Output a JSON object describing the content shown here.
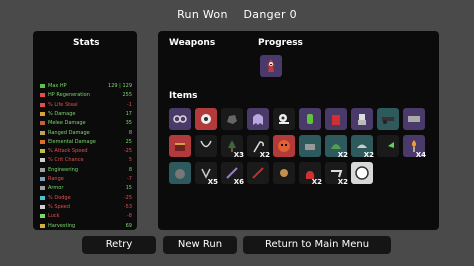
{
  "header": {
    "result": "Run Won",
    "danger": "Danger 0"
  },
  "stats": {
    "title": "Stats",
    "rows": [
      {
        "label": "Max HP",
        "value": "129 | 129",
        "color": "#7bd86d",
        "icon_color": "#5cc04a",
        "icon": "heart-icon"
      },
      {
        "label": "HP Regeneration",
        "value": "255",
        "color": "#7bd86d",
        "icon_color": "#e05050",
        "icon": "regen-icon"
      },
      {
        "label": "% Life Steal",
        "value": "-1",
        "color": "#e05050",
        "icon_color": "#e05050",
        "icon": "lifesteal-icon"
      },
      {
        "label": "% Damage",
        "value": "17",
        "color": "#7bd86d",
        "icon_color": "#d8a040",
        "icon": "damage-icon"
      },
      {
        "label": "Melee Damage",
        "value": "35",
        "color": "#7bd86d",
        "icon_color": "#c06040",
        "icon": "melee-icon"
      },
      {
        "label": "Ranged Damage",
        "value": "8",
        "color": "#7bd86d",
        "icon_color": "#c0a060",
        "icon": "ranged-icon"
      },
      {
        "label": "Elemental Damage",
        "value": "25",
        "color": "#7bd86d",
        "icon_color": "#e07020",
        "icon": "elemental-icon"
      },
      {
        "label": "% Attack Speed",
        "value": "-25",
        "color": "#e05050",
        "icon_color": "#c0c040",
        "icon": "attack-speed-icon"
      },
      {
        "label": "% Crit Chance",
        "value": "5",
        "color": "#e05050",
        "icon_color": "#d0d0d0",
        "icon": "crit-icon"
      },
      {
        "label": "Engineering",
        "value": "8",
        "color": "#7bd86d",
        "icon_color": "#a0a0a0",
        "icon": "engineering-icon"
      },
      {
        "label": "Range",
        "value": "-7",
        "color": "#e05050",
        "icon_color": "#80a0c0",
        "icon": "range-icon"
      },
      {
        "label": "Armor",
        "value": "15",
        "color": "#7bd86d",
        "icon_color": "#a0a0a0",
        "icon": "armor-icon"
      },
      {
        "label": "% Dodge",
        "value": "-25",
        "color": "#e05050",
        "icon_color": "#50c0d0",
        "icon": "dodge-icon"
      },
      {
        "label": "% Speed",
        "value": "-53",
        "color": "#e05050",
        "icon_color": "#d0d0d0",
        "icon": "speed-icon"
      },
      {
        "label": "Luck",
        "value": "-8",
        "color": "#e05050",
        "icon_color": "#7bd86d",
        "icon": "luck-icon"
      },
      {
        "label": "Harvesting",
        "value": "69",
        "color": "#7bd86d",
        "icon_color": "#d0b040",
        "icon": "harvesting-icon"
      }
    ]
  },
  "weapons": {
    "title": "Weapons"
  },
  "progress": {
    "title": "Progress",
    "items": [
      {
        "icon": "character-icon",
        "color": "#c03a3a"
      }
    ]
  },
  "items": {
    "title": "Items",
    "list": [
      {
        "icon": "goggles-icon",
        "bg": "#4a3a6a",
        "qty": ""
      },
      {
        "icon": "spiked-ball-icon",
        "bg": "#b33a3a",
        "qty": ""
      },
      {
        "icon": "rock-icon",
        "bg": "#1a1a1a",
        "qty": ""
      },
      {
        "icon": "ghost-icon",
        "bg": "#4a3a6a",
        "qty": ""
      },
      {
        "icon": "snail-icon",
        "bg": "#1a1a1a",
        "qty": ""
      },
      {
        "icon": "potion-icon",
        "bg": "#4a3a6a",
        "qty": ""
      },
      {
        "icon": "fuel-can-icon",
        "bg": "#4a3a6a",
        "qty": ""
      },
      {
        "icon": "robot-icon",
        "bg": "#4a3a6a",
        "qty": ""
      },
      {
        "icon": "cannon-icon",
        "bg": "#2e5a5e",
        "qty": ""
      },
      {
        "icon": "ammo-icon",
        "bg": "#4a3a6a",
        "qty": ""
      },
      {
        "icon": "chest-icon",
        "bg": "#b33a3a",
        "qty": ""
      },
      {
        "icon": "necklace-icon",
        "bg": "#1a1a1a",
        "qty": ""
      },
      {
        "icon": "tree-icon",
        "bg": "#1a1a1a",
        "qty": "X3"
      },
      {
        "icon": "scythe-icon",
        "bg": "#1a1a1a",
        "qty": "X2"
      },
      {
        "icon": "mask-icon",
        "bg": "#b33a3a",
        "qty": ""
      },
      {
        "icon": "trap-icon",
        "bg": "#2e5a5e",
        "qty": ""
      },
      {
        "icon": "helmet-icon",
        "bg": "#2e5a5e",
        "qty": "X2"
      },
      {
        "icon": "cap-icon",
        "bg": "#2e5a5e",
        "qty": "X2"
      },
      {
        "icon": "fan-icon",
        "bg": "#1a1a1a",
        "qty": ""
      },
      {
        "icon": "torch-icon",
        "bg": "#4a3a6a",
        "qty": "X4"
      },
      {
        "icon": "grenade-icon",
        "bg": "#2e5a5e",
        "qty": ""
      },
      {
        "icon": "claw-icon",
        "bg": "#1a1a1a",
        "qty": "X5"
      },
      {
        "icon": "wand-icon",
        "bg": "#1a1a1a",
        "qty": "X6"
      },
      {
        "icon": "sword-icon",
        "bg": "#1a1a1a",
        "qty": ""
      },
      {
        "icon": "bug-icon",
        "bg": "#1a1a1a",
        "qty": ""
      },
      {
        "icon": "sack-icon",
        "bg": "#1a1a1a",
        "qty": "X2"
      },
      {
        "icon": "scarf-icon",
        "bg": "#1a1a1a",
        "qty": "X2"
      },
      {
        "icon": "coin-icon",
        "bg": "#d8d8d8",
        "qty": ""
      }
    ]
  },
  "buttons": {
    "retry": "Retry",
    "new_run": "New Run",
    "main_menu": "Return to Main Menu"
  }
}
